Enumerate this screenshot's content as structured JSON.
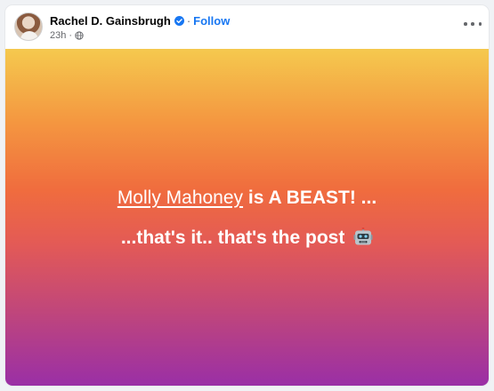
{
  "post": {
    "author": {
      "name": "Rachel D. Gainsbrugh",
      "follow_label": "Follow",
      "separator": "·"
    },
    "meta": {
      "time": "23h",
      "separator": "·",
      "audience_icon": "globe-icon"
    },
    "more_icon": "more-options-icon",
    "content": {
      "mention": "Molly Mahoney",
      "line1_rest": " is A BEAST! ...",
      "line2": "...that's it.. that's the post",
      "emoji": "robot-emoji"
    },
    "colors": {
      "follow": "#1877f2",
      "verified": "#1877f2",
      "gradient_top": "#f5c94e",
      "gradient_mid": "#f06c3e",
      "gradient_bottom": "#9a2fa6",
      "text": "#ffffff"
    }
  }
}
